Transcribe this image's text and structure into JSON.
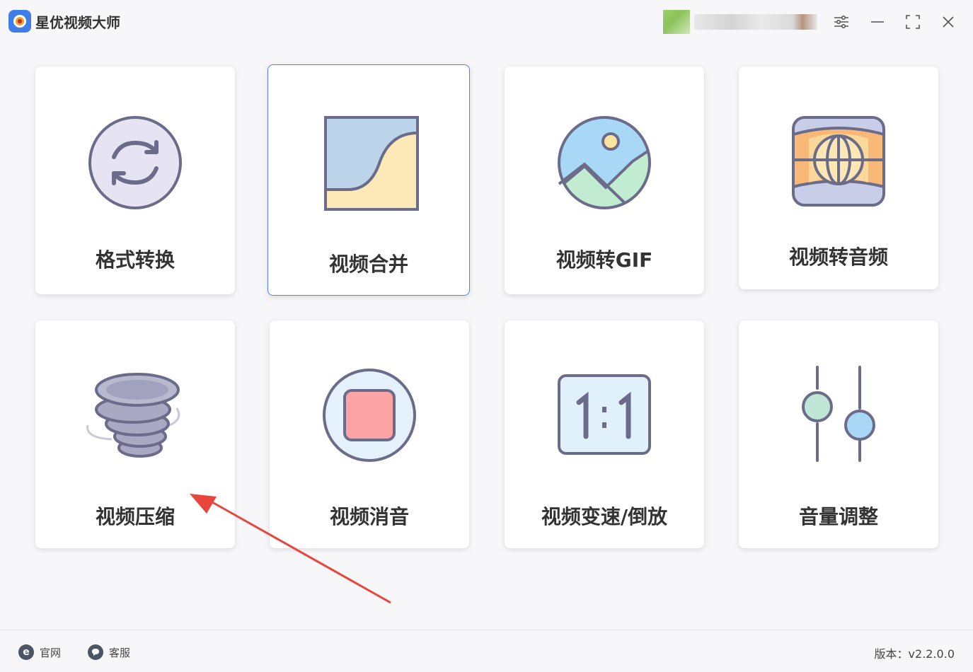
{
  "app": {
    "title": "星优视频大师"
  },
  "cards": [
    {
      "label": "格式转换"
    },
    {
      "label": "视频合并"
    },
    {
      "label": "视频转GIF"
    },
    {
      "label": "视频转音频"
    },
    {
      "label": "视频压缩"
    },
    {
      "label": "视频消音"
    },
    {
      "label": "视频变速/倒放"
    },
    {
      "label": "音量调整"
    }
  ],
  "footer": {
    "website_label": "官网",
    "support_label": "客服",
    "version_text": "版本：v2.2.0.0"
  },
  "colors": {
    "accent_border": "#5b7fe0",
    "icon_stroke": "#6b6b8a",
    "annotation_arrow": "#e8453c"
  },
  "icons": {
    "format": "refresh-icon",
    "merge": "merge-curve-icon",
    "gif": "image-icon",
    "audio": "globe-audio-icon",
    "compress": "tornado-icon",
    "mute": "stop-icon",
    "speed": "ratio-icon",
    "volume": "sliders-icon"
  }
}
